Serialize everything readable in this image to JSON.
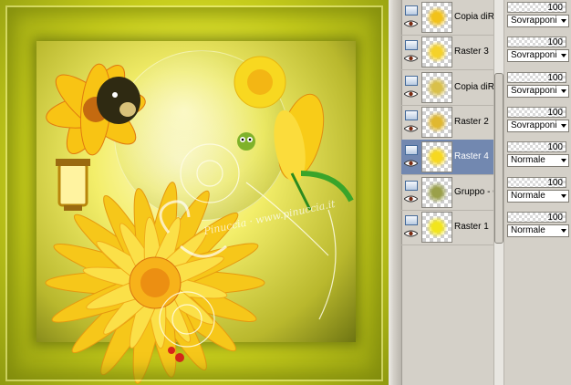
{
  "canvas": {
    "watermark": "Pinuccia · www.pinuccia.it"
  },
  "layers": [
    {
      "name": "Copia diRa",
      "opacity": "100",
      "blend": "Sovrapponi",
      "selected": false
    },
    {
      "name": "Raster 3",
      "opacity": "100",
      "blend": "Sovrapponi",
      "selected": false
    },
    {
      "name": "Copia diRa",
      "opacity": "100",
      "blend": "Sovrapponi",
      "selected": false
    },
    {
      "name": "Raster 2",
      "opacity": "100",
      "blend": "Sovrapponi",
      "selected": false
    },
    {
      "name": "Raster 4",
      "opacity": "100",
      "blend": "Normale",
      "selected": true
    },
    {
      "name": "Gruppo - C",
      "opacity": "100",
      "blend": "Normale",
      "selected": false
    },
    {
      "name": "Raster 1",
      "opacity": "100",
      "blend": "Normale",
      "selected": false
    }
  ],
  "colors": {
    "selection": "#7288b0",
    "panel": "#d4d0c8",
    "accent_yellow": "#f2e51c"
  }
}
